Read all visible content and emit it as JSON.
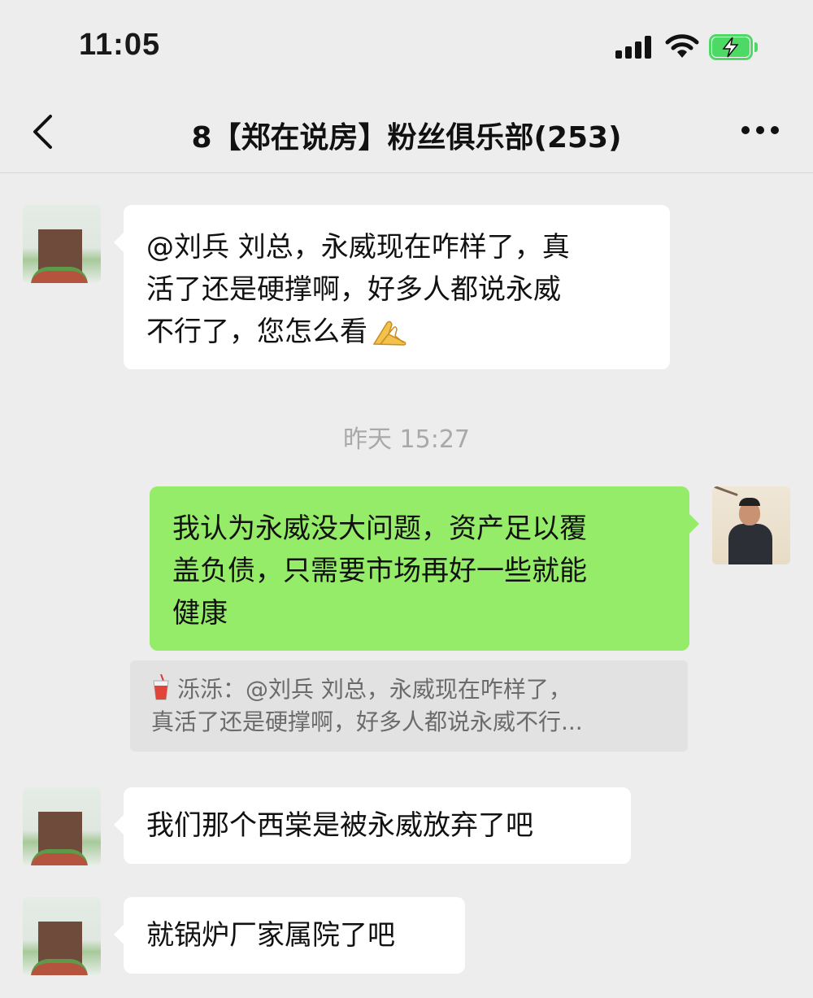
{
  "status_bar": {
    "time": "11:05",
    "icons": [
      "signal-icon",
      "wifi-icon",
      "battery-charging-icon"
    ],
    "battery_color": "#4cd964"
  },
  "nav": {
    "back_icon": "chevron-left-icon",
    "title": "8【郑在说房】粉丝俱乐部(253)",
    "more_icon": "more-dots-icon"
  },
  "messages": [
    {
      "direction": "incoming",
      "lines": [
        "@刘兵 刘总，永威现在咋样了，真",
        "活了还是硬撑啊，好多人都说永威",
        "不行了，您怎么看"
      ],
      "trailing_emoji": "folded-hands-icon"
    },
    {
      "direction": "outgoing",
      "lines": [
        "我认为永威没大问题，资产足以覆",
        "盖负债，只需要市场再好一些就能",
        "健康"
      ]
    },
    {
      "direction": "incoming",
      "lines": [
        "我们那个西棠是被永威放弃了吧"
      ]
    },
    {
      "direction": "incoming",
      "lines": [
        "就锅炉厂家属院了吧"
      ]
    }
  ],
  "timestamp": "昨天 15:27",
  "quote": {
    "icon": "drink-cup-icon",
    "line1": "泺泺：@刘兵 刘总，永威现在咋样了，",
    "line2": "真活了还是硬撑啊，好多人都说永威不行..."
  },
  "colors": {
    "background": "#ededed",
    "incoming_bubble": "#ffffff",
    "outgoing_bubble": "#95ec69",
    "quote_bg": "#e2e2e2"
  }
}
